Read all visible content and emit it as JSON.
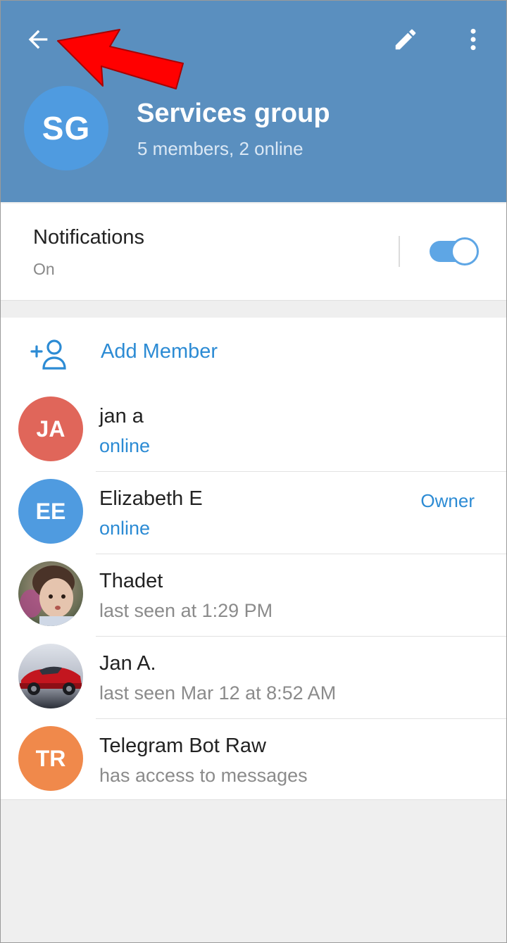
{
  "header": {
    "group_initials": "SG",
    "group_name": "Services group",
    "group_subtitle": "5 members, 2 online",
    "colors": {
      "header_bg": "#5a8fbf",
      "avatar_bg": "#4f9be0"
    }
  },
  "icons": {
    "back": "arrow-left-icon",
    "edit": "pencil-icon",
    "more": "more-vertical-icon",
    "add_member": "add-person-icon"
  },
  "notifications": {
    "title": "Notifications",
    "status": "On",
    "enabled": true
  },
  "add_member_label": "Add Member",
  "members": [
    {
      "initials": "JA",
      "name": "jan a",
      "status": "online",
      "avatar_color": "#e0665a"
    },
    {
      "initials": "EE",
      "name": "Elizabeth E",
      "status": "online",
      "badge": "Owner",
      "avatar_color": "#4f9be0"
    },
    {
      "initials": "",
      "name": "Thadet",
      "status": "last seen at 1:29 PM",
      "avatar_image": "child-photo"
    },
    {
      "initials": "",
      "name": "Jan A.",
      "status": "last seen Mar 12 at 8:52 AM",
      "avatar_image": "red-car-photo"
    },
    {
      "initials": "TR",
      "name": "Telegram Bot Raw",
      "status": "has access to messages",
      "avatar_color": "#f0894b"
    }
  ],
  "accent_color": "#2c8bd4",
  "annotation_color": "#ff0000"
}
